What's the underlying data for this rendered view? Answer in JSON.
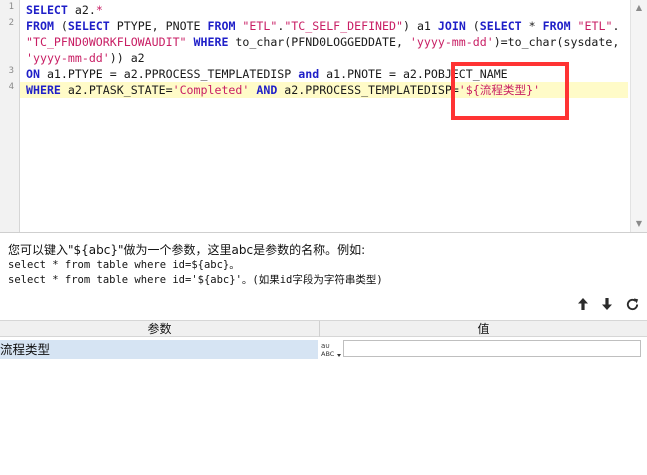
{
  "editor": {
    "line_numbers": [
      "1",
      "2",
      "3",
      "4"
    ],
    "lines": [
      [
        {
          "t": "kw",
          "v": "SELECT"
        },
        {
          "t": "txt",
          "v": " a2."
        },
        {
          "t": "str",
          "v": "*"
        }
      ],
      [
        {
          "t": "kw",
          "v": "FROM"
        },
        {
          "t": "txt",
          "v": " ("
        },
        {
          "t": "kw",
          "v": "SELECT"
        },
        {
          "t": "txt",
          "v": " PTYPE, PNOTE "
        },
        {
          "t": "kw",
          "v": "FROM"
        },
        {
          "t": "txt",
          "v": " "
        },
        {
          "t": "str",
          "v": "\"ETL\""
        },
        {
          "t": "txt",
          "v": "."
        },
        {
          "t": "str",
          "v": "\"TC_SELF_DEFINED\""
        },
        {
          "t": "txt",
          "v": ") a1 "
        },
        {
          "t": "kw",
          "v": "JOIN"
        },
        {
          "t": "txt",
          "v": " ("
        },
        {
          "t": "kw",
          "v": "SELECT"
        },
        {
          "t": "txt",
          "v": " * "
        },
        {
          "t": "kw",
          "v": "FROM"
        },
        {
          "t": "txt",
          "v": " "
        },
        {
          "t": "str",
          "v": "\"ETL\""
        },
        {
          "t": "txt",
          "v": "."
        }
      ],
      [
        {
          "t": "str",
          "v": "\"TC_PFND0WORKFLOWAUDIT\""
        },
        {
          "t": "txt",
          "v": " "
        },
        {
          "t": "kw",
          "v": "WHERE"
        },
        {
          "t": "txt",
          "v": " to_char(PFND0LOGGEDDATE, "
        },
        {
          "t": "str",
          "v": "'yyyy-mm-dd'"
        },
        {
          "t": "txt",
          "v": ")=to_char(sysdate,"
        }
      ],
      [
        {
          "t": "str",
          "v": "'yyyy-mm-dd'"
        },
        {
          "t": "txt",
          "v": ")) a2"
        }
      ],
      [
        {
          "t": "kw",
          "v": "ON"
        },
        {
          "t": "txt",
          "v": " a1.PTYPE = a2.PPROCESS_TEMPLATEDISP "
        },
        {
          "t": "kw",
          "v": "and"
        },
        {
          "t": "txt",
          "v": " a1.PNOTE = a2.POBJECT_NAME"
        }
      ],
      [
        {
          "t": "kw",
          "v": "WHERE"
        },
        {
          "t": "txt",
          "v": " a2.PTASK_STATE="
        },
        {
          "t": "str",
          "v": "'Completed'"
        },
        {
          "t": "txt",
          "v": " "
        },
        {
          "t": "kw",
          "v": "AND"
        },
        {
          "t": "txt",
          "v": " a2.PPROCESS_TEMPLATEDISP="
        },
        {
          "t": "str",
          "v": "'${流程类型}'"
        }
      ]
    ]
  },
  "help": {
    "line1": "您可以键入\"${abc}\"做为一个参数，这里abc是参数的名称。例如:",
    "line2": "select * from table where id=${abc}。",
    "line3": "select * from table where id='${abc}'。(如果id字段为字符串类型)"
  },
  "toolbar": {
    "move_up_icon": "arrow-up-icon",
    "move_down_icon": "arrow-down-icon",
    "refresh_icon": "refresh-icon"
  },
  "param_table": {
    "headers": {
      "name": "参数",
      "value": "值"
    },
    "rows": [
      {
        "name": "流程类型",
        "type_icon": "abc-string-type-icon",
        "value": ""
      }
    ]
  },
  "colors": {
    "keyword": "#1f1fc8",
    "string": "#c81e64",
    "current_line": "#fffbc8",
    "selected_row": "#d6e4f3",
    "annotation_box": "#ff3333"
  }
}
